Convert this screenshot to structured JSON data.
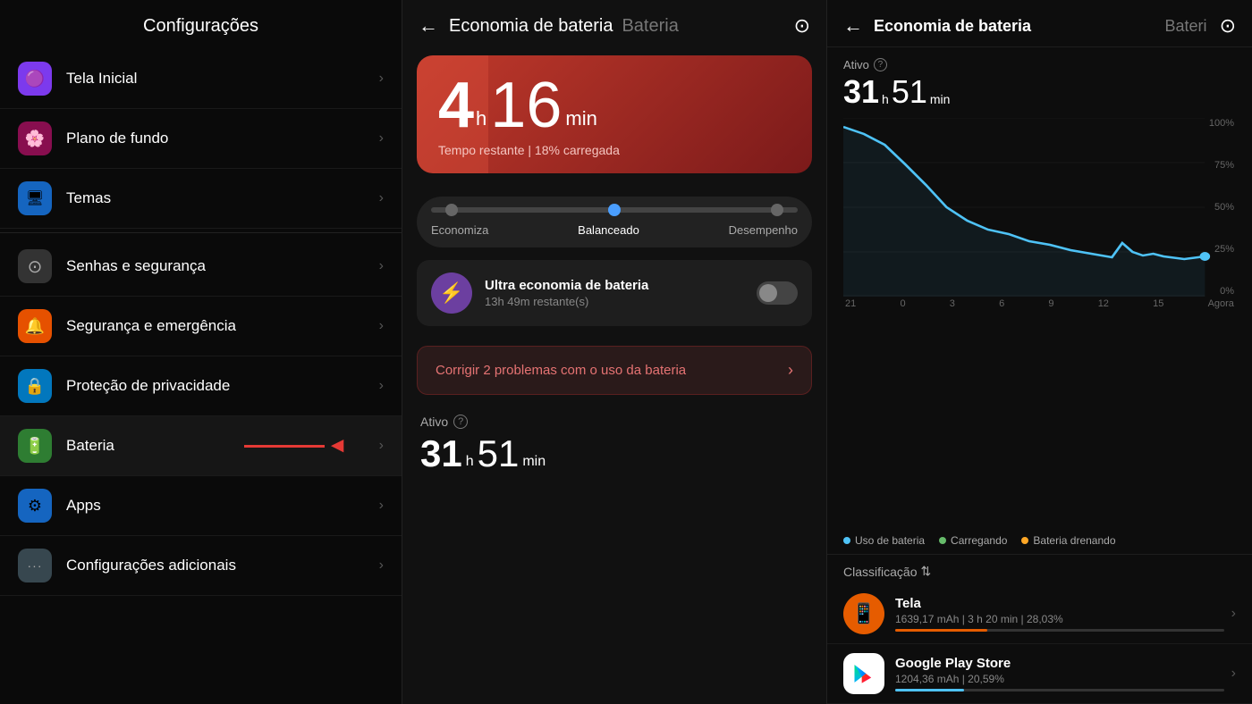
{
  "left": {
    "title": "Configurações",
    "items": [
      {
        "id": "tela-inicial",
        "label": "Tela Inicial",
        "icon": "🟣",
        "icon_bg": "#7c3aed"
      },
      {
        "id": "plano-de-fundo",
        "label": "Plano de fundo",
        "icon": "🌸",
        "icon_bg": "#e91e8c"
      },
      {
        "id": "temas",
        "label": "Temas",
        "icon": "🖥️",
        "icon_bg": "#2196f3"
      },
      {
        "id": "senhas",
        "label": "Senhas e segurança",
        "icon": "⊙",
        "icon_bg": "#444"
      },
      {
        "id": "seguranca",
        "label": "Segurança e emergência",
        "icon": "🔔",
        "icon_bg": "#ff9800"
      },
      {
        "id": "privacidade",
        "label": "Proteção de privacidade",
        "icon": "🔒",
        "icon_bg": "#03a9f4"
      },
      {
        "id": "bateria",
        "label": "Bateria",
        "icon": "🔋",
        "icon_bg": "#4caf50",
        "arrow": true
      },
      {
        "id": "apps",
        "label": "Apps",
        "icon": "⚙",
        "icon_bg": "#2196f3"
      },
      {
        "id": "config-adicionais",
        "label": "Configurações adicionais",
        "icon": "···",
        "icon_bg": "#607d8b"
      }
    ]
  },
  "mid": {
    "back_label": "←",
    "title_active": "Economia de bateria",
    "title_inactive": "Bateria",
    "gear_icon": "⊙",
    "battery_hours": "4",
    "battery_h_label": "h",
    "battery_mins": "16",
    "battery_min_label": "min",
    "battery_subtitle": "Tempo restante | 18% carregada",
    "slider": {
      "labels": [
        "Economiza",
        "Balanceado",
        "Desempenho"
      ]
    },
    "ultra": {
      "icon": "⚡",
      "title": "Ultra economia de bateria",
      "subtitle": "13h 49m restante(s)"
    },
    "fix_btn": {
      "text": "Corrigir 2 problemas com o uso da bateria",
      "arrow": "›"
    },
    "ativo": {
      "label": "Ativo",
      "hours": "31",
      "h_label": "h",
      "mins": "51",
      "min_label": "min"
    }
  },
  "right": {
    "back_label": "←",
    "title": "Economia de bateria",
    "tab_inactive": "Bateri",
    "gear_icon": "⊙",
    "ativo": {
      "label": "Ativo",
      "hours": "31",
      "h_label": "h",
      "mins": "51",
      "min_label": "min"
    },
    "chart": {
      "x_labels": [
        "21",
        "0",
        "3",
        "6",
        "9",
        "12",
        "15",
        "Agora"
      ],
      "y_labels": [
        "100%",
        "75%",
        "50%",
        "25%",
        "0%"
      ]
    },
    "legend": [
      {
        "id": "uso",
        "label": "Uso de bateria",
        "color": "#4fc3f7"
      },
      {
        "id": "carregando",
        "label": "Carregando",
        "color": "#66bb6a"
      },
      {
        "id": "drenando",
        "label": "Bateria drenando",
        "color": "#ffa726"
      }
    ],
    "classification_label": "Classificação",
    "apps": [
      {
        "name": "Tela",
        "icon": "📱",
        "icon_bg": "#e65c00",
        "stats": "1639,17 mAh | 3 h 20 min  | 28,03%",
        "bar_color": "#e65c00",
        "bar_pct": 28
      },
      {
        "name": "Google Play Store",
        "icon": "▶",
        "icon_bg": "#1a73e8",
        "stats": "1204,36 mAh | 20,59%",
        "bar_color": "#4fc3f7",
        "bar_pct": 21
      }
    ]
  }
}
